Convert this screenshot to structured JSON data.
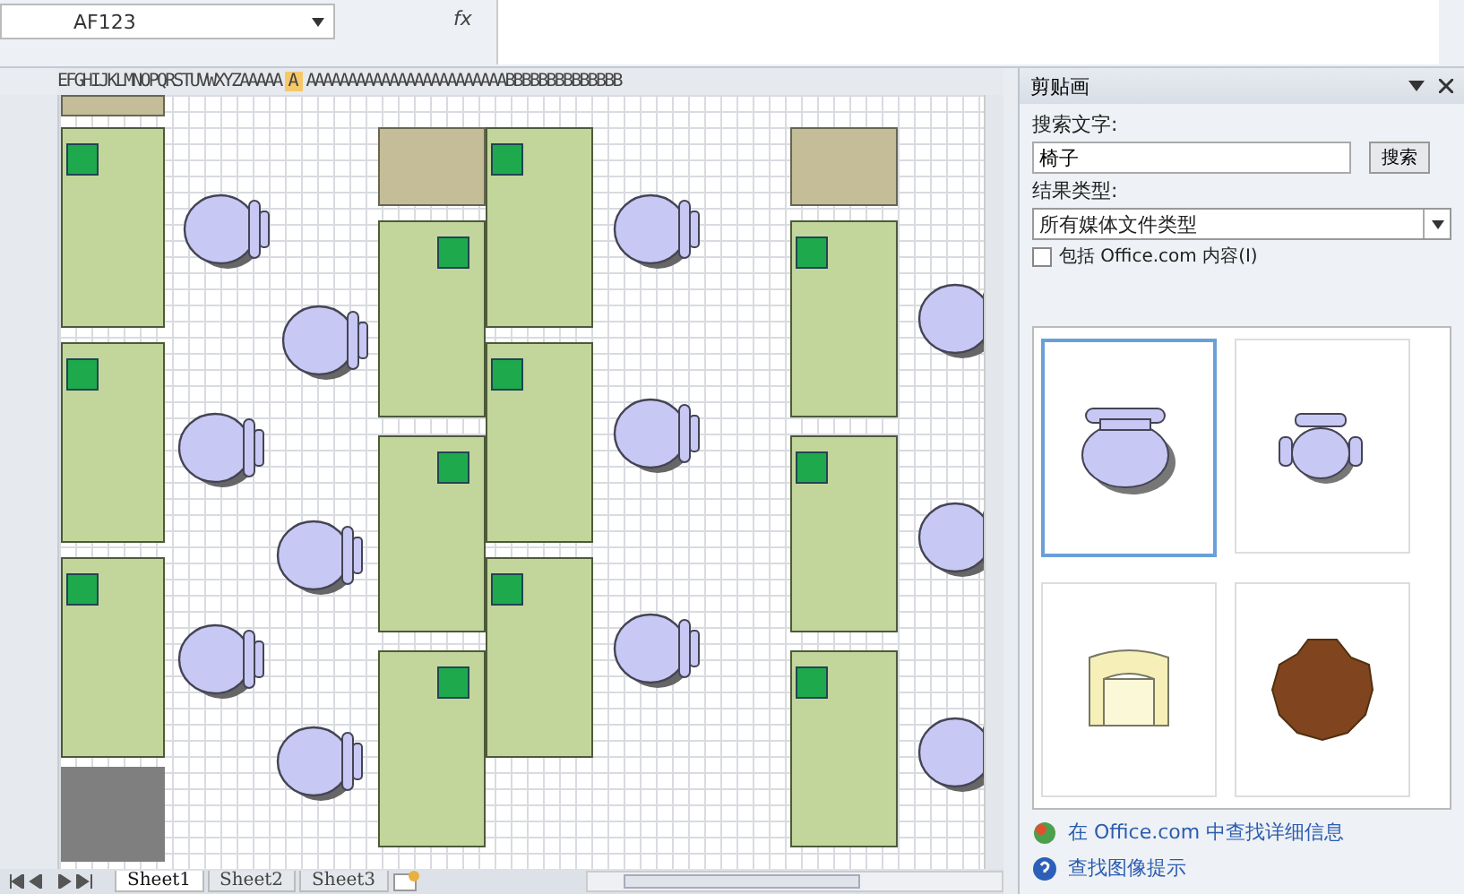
{
  "formula_bar": {
    "name_box": "AF123",
    "fx": "fx"
  },
  "column_header": {
    "before": "EFGHIJKLMNOPQRSTUVWXYZAAAAA",
    "active": "A",
    "after": "AAAAAAAAAAAAAAAAAAAAAAAABBBBBBBBBBBBBB"
  },
  "sheet_tabs": [
    {
      "label": "Sheet1",
      "selected": true
    },
    {
      "label": "Sheet2",
      "selected": false
    },
    {
      "label": "Sheet3",
      "selected": false
    }
  ],
  "task_pane": {
    "title": "剪贴画",
    "search_label": "搜索文字:",
    "search_value": "椅子",
    "search_button": "搜索",
    "results_label": "结果类型:",
    "results_value": "所有媒体文件类型",
    "include_office": {
      "label": "包括 Office.com 内容(I)",
      "checked": false
    },
    "results": [
      {
        "kind": "chair-top",
        "selected": true
      },
      {
        "kind": "chair-small",
        "selected": false
      },
      {
        "kind": "armchair",
        "selected": false
      },
      {
        "kind": "table-round",
        "selected": false
      }
    ],
    "links": [
      "在 Office.com 中查找详细信息",
      "查找图像提示"
    ]
  }
}
